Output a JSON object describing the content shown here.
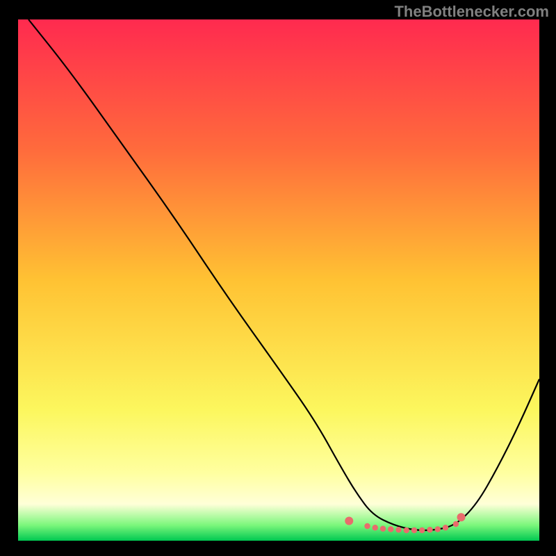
{
  "watermark": "TheBottlenecker.com",
  "chart_data": {
    "type": "line",
    "title": "",
    "xlabel": "",
    "ylabel": "",
    "xlim": [
      0,
      100
    ],
    "ylim": [
      0,
      100
    ],
    "series": [
      {
        "name": "gradient-bg",
        "type": "fill",
        "stops": [
          {
            "pos": 0,
            "color": "#FF2A4F"
          },
          {
            "pos": 25,
            "color": "#FF6B3C"
          },
          {
            "pos": 50,
            "color": "#FFC233"
          },
          {
            "pos": 75,
            "color": "#FCF75E"
          },
          {
            "pos": 87,
            "color": "#FFFFA0"
          },
          {
            "pos": 93,
            "color": "#FFFFD8"
          },
          {
            "pos": 97,
            "color": "#7CF77C"
          },
          {
            "pos": 100,
            "color": "#00C851"
          }
        ]
      },
      {
        "name": "curve",
        "type": "line",
        "color": "#000000",
        "x": [
          2,
          10,
          20,
          30,
          40,
          50,
          57,
          62,
          65,
          68,
          72,
          76,
          80,
          84,
          88,
          92,
          96,
          100
        ],
        "y": [
          100,
          90,
          76,
          62,
          47,
          33,
          23,
          14,
          9,
          5,
          3,
          2,
          2,
          3,
          7,
          14,
          22,
          31
        ]
      },
      {
        "name": "bottom-markers",
        "type": "scatter",
        "color": "#E86C6C",
        "x": [
          63.5,
          67,
          68.5,
          70,
          71.5,
          73,
          74.5,
          76,
          77.5,
          79,
          80.5,
          82,
          84,
          85
        ],
        "y": [
          3.8,
          2.8,
          2.5,
          2.3,
          2.2,
          2.1,
          2.0,
          2.0,
          2.0,
          2.1,
          2.2,
          2.5,
          3.2,
          4.5
        ]
      }
    ]
  }
}
